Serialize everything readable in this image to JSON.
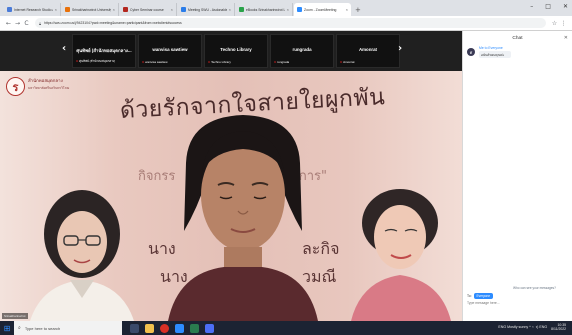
{
  "browser": {
    "tabs": [
      {
        "label": "Internet Research Studio Author",
        "active": false,
        "fav_color": "#4a7bd8"
      },
      {
        "label": "Srinakharinwirot University - ar",
        "active": false,
        "fav_color": "#e8710a"
      },
      {
        "label": "Cyber Seminar course",
        "active": false,
        "fav_color": "#b3261e"
      },
      {
        "label": "Meeting SWU - Asdonalds",
        "active": false,
        "fav_color": "#2b7de9"
      },
      {
        "label": "eBooks Srinakharinwirot Librar",
        "active": false,
        "fav_color": "#2aa34a"
      },
      {
        "label": "Zoom - ZoomMeeting",
        "active": true,
        "fav_color": "#2d8cff"
      }
    ],
    "new_tab": "+",
    "window_controls": [
      "–",
      "□",
      "✕"
    ],
    "nav": {
      "back": "←",
      "forward": "→",
      "reload": "C",
      "home": "⌂"
    },
    "url": "https://swu.zoom.us/j/9423104?pwd=meeting&uname=participant&from=webclient#success",
    "actions": [
      "☆",
      "⋮"
    ]
  },
  "meeting": {
    "participants": [
      {
        "name": "ศุนทิพย์ (สำนักหอสมุดกลาง...",
        "caption": "ศุนทิพย์ (สำนักหอสมุดกลาง)"
      },
      {
        "name": "wanvisa sawtiew",
        "caption": "wanvisa sawtiew"
      },
      {
        "name": "Techno Library",
        "caption": "Techno Library"
      },
      {
        "name": "rungrada",
        "caption": "rungrada"
      },
      {
        "name": "Amonrat",
        "caption": "Amonrat"
      }
    ],
    "prev": "‹",
    "next": "›",
    "mic_icon": "⧉"
  },
  "slide": {
    "seal_char": "ร",
    "org_name": "สำนักหอสมุดกลาง",
    "org_sub": "มหาวิทยาลัยศรีนครินทรวิโรฒ",
    "headline": "ด้วยรักจากใจสายใยผูกพัน",
    "line2a": "กิจกรร",
    "line2b": "ชการ\"",
    "line3a": "นาง",
    "line3b": "ละกิจ",
    "line4a": "นาง",
    "line4b": "วมณี",
    "presenter_tag": "Srinakharinwirot"
  },
  "chat": {
    "title": "Chat",
    "close": "✕",
    "from": "Me to Everyone",
    "avatar": "ศ",
    "message": "อนันต์ขอบคุณค่ะ",
    "who_label": "Who can see your messages?",
    "to_label": "To:",
    "to_value": "Everyone",
    "placeholder": "Type message here..."
  },
  "taskbar": {
    "search": "Type here to search",
    "tray": "ENG  Mostly sunny  ^  ⌁  ◑)  ENG",
    "time": "10:35",
    "date": "8/11/2022"
  },
  "colors": {
    "accent": "#2d8cff",
    "slide_text": "#4a2b2b",
    "seal": "#b0342f"
  }
}
